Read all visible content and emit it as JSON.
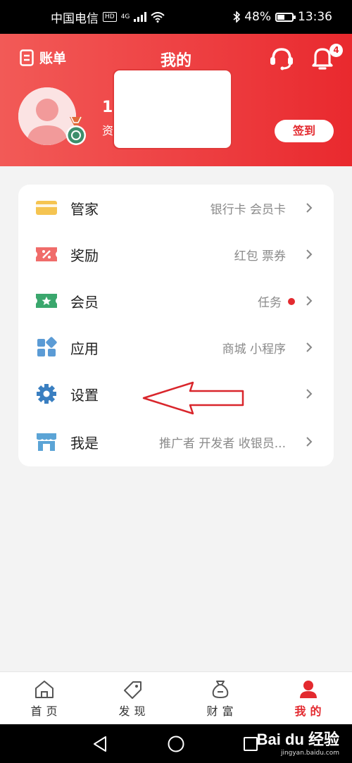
{
  "status_bar": {
    "carrier": "中国电信",
    "hd": "HD",
    "network": "4G",
    "battery_percent": "48%",
    "battery_level": 0.48,
    "time": "13:36"
  },
  "header": {
    "bill_label": "账单",
    "title": "我的",
    "notification_count": "4",
    "user_number_visible": "1",
    "user_sub_visible": "资",
    "checkin_label": "签到"
  },
  "menu": {
    "items": [
      {
        "label": "管家",
        "value": "银行卡 会员卡",
        "icon": "card-icon",
        "color": "#f5c451"
      },
      {
        "label": "奖励",
        "value": "红包 票券",
        "icon": "coupon-icon",
        "color": "#f06c6a"
      },
      {
        "label": "会员",
        "value": "任务",
        "icon": "member-ticket-icon",
        "color": "#3aa76d",
        "dot": true
      },
      {
        "label": "应用",
        "value": "商城 小程序",
        "icon": "apps-grid-icon",
        "color": "#5b9bd5"
      },
      {
        "label": "设置",
        "value": "",
        "icon": "gear-icon",
        "color": "#3a7fc1"
      },
      {
        "label": "我是",
        "value": "推广者 开发者 收银员...",
        "icon": "store-icon",
        "color": "#5ba4d6"
      }
    ]
  },
  "tabbar": {
    "tabs": [
      {
        "label": "首页",
        "icon": "home-icon"
      },
      {
        "label": "发现",
        "icon": "tag-icon"
      },
      {
        "label": "财富",
        "icon": "money-bag-icon"
      },
      {
        "label": "我的",
        "icon": "person-icon",
        "active": true
      }
    ]
  },
  "watermark": {
    "logo": "Bai du 经验",
    "url": "jingyan.baidu.com"
  },
  "colors": {
    "brand_red": "#e9292e",
    "header_gradient_start": "#f25a57",
    "notification_dot": "#e32a2f"
  }
}
